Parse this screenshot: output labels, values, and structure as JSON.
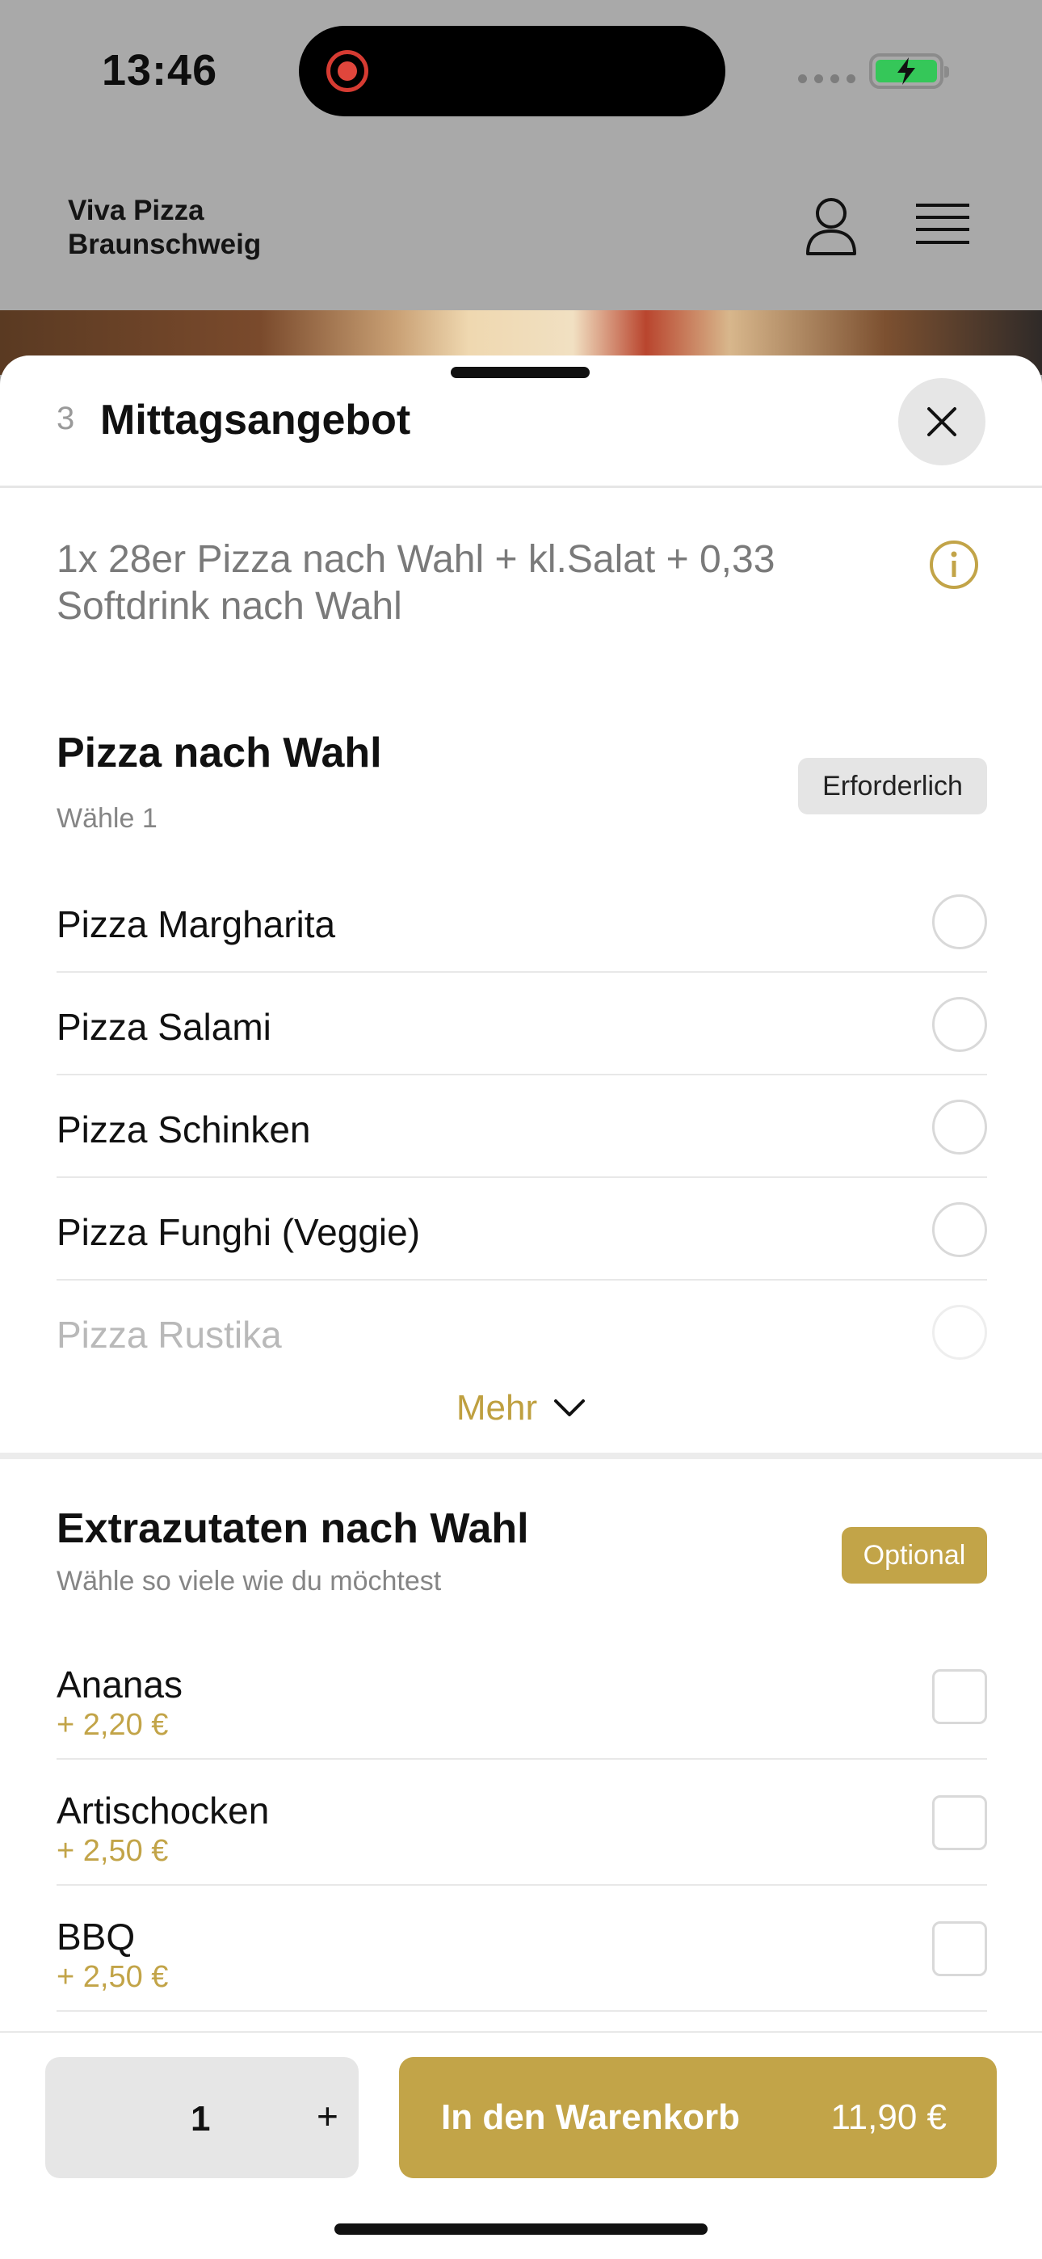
{
  "status_bar": {
    "time": "13:46"
  },
  "app": {
    "brand_line1": "Viva Pizza",
    "brand_line2": "Braunschweig"
  },
  "sheet": {
    "item_number": "3",
    "title": "Mittagsangebot",
    "description": "1x 28er Pizza nach Wahl + kl.Salat + 0,33 Softdrink nach Wahl"
  },
  "pizza_group": {
    "title": "Pizza nach Wahl",
    "subtitle": "Wähle 1",
    "badge": "Erforderlich",
    "options": [
      {
        "label": "Pizza Margharita"
      },
      {
        "label": "Pizza Salami"
      },
      {
        "label": "Pizza Schinken"
      },
      {
        "label": "Pizza Funghi (Veggie)"
      },
      {
        "label": "Pizza Rustika"
      }
    ],
    "more_label": "Mehr"
  },
  "extras_group": {
    "title": "Extrazutaten nach Wahl",
    "subtitle": "Wähle so viele wie du möchtest",
    "badge": "Optional",
    "options": [
      {
        "label": "Ananas",
        "price": "+ 2,20 €"
      },
      {
        "label": "Artischocken",
        "price": "+ 2,50 €"
      },
      {
        "label": "BBQ",
        "price": "+ 2,50 €"
      }
    ]
  },
  "footer": {
    "quantity": "1",
    "plus": "+",
    "cart_label": "In den Warenkorb",
    "cart_price": "11,90 €"
  },
  "colors": {
    "accent": "#c2a448",
    "battery": "#35c759",
    "record": "#e0463c"
  }
}
